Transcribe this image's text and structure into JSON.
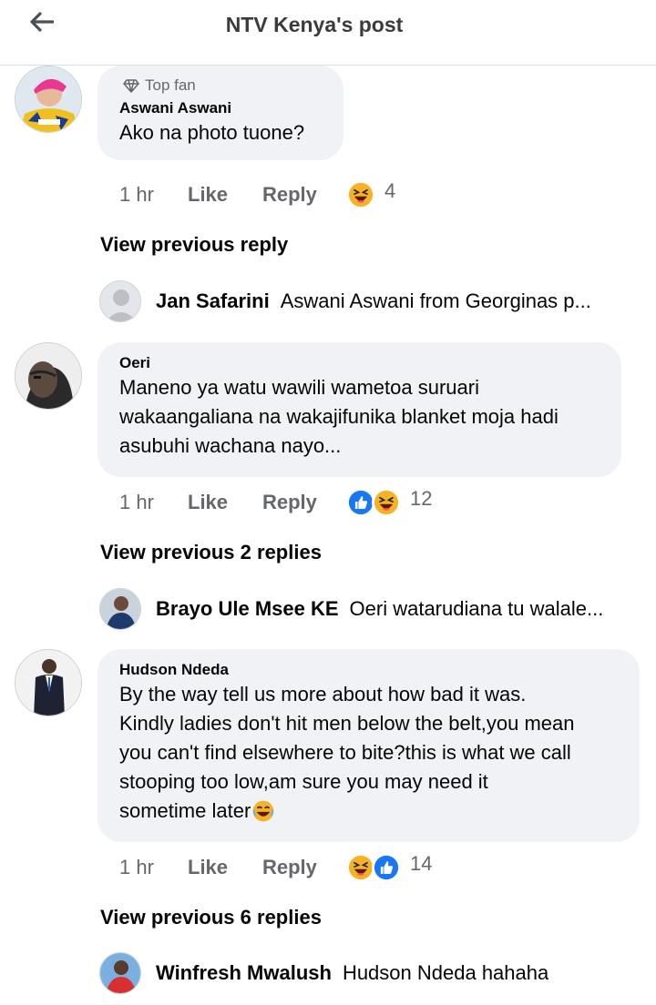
{
  "header": {
    "title": "NTV Kenya's post"
  },
  "comments": [
    {
      "badge": "Top fan",
      "author": "Aswani Aswani",
      "text": "Ako na photo tuone?",
      "time": "1 hr",
      "like": "Like",
      "reply": "Reply",
      "reactions": [
        "haha"
      ],
      "reaction_count": "4",
      "view_previous": "View previous reply",
      "latest_reply": {
        "name": "Jan Safarini",
        "text": "Aswani Aswani from Georginas p..."
      }
    },
    {
      "author": "Oeri",
      "text_lines": [
        "Maneno ya watu wawili wametoa suruari",
        "wakaangaliana na wakajifunika blanket moja hadi",
        "asubuhi wachana nayo..."
      ],
      "time": "1 hr",
      "like": "Like",
      "reply": "Reply",
      "reactions": [
        "like",
        "haha"
      ],
      "reaction_count": "12",
      "view_previous": "View previous 2 replies",
      "latest_reply": {
        "name": "Brayo Ule Msee KE",
        "text": "Oeri watarudiana tu walale..."
      }
    },
    {
      "author": "Hudson Ndeda",
      "text_lines": [
        "By the way tell us more about how bad it was.",
        "Kindly ladies don't hit men below the belt,you mean",
        "you can't find elsewhere to bite?this is what we call",
        "stooping too low,am sure you may need it",
        "sometime later"
      ],
      "time": "1 hr",
      "like": "Like",
      "reply": "Reply",
      "reactions": [
        "haha",
        "like"
      ],
      "reaction_count": "14",
      "view_previous": "View previous 6 replies",
      "latest_reply": {
        "name": "Winfresh Mwalush",
        "text": "Hudson Ndeda hahaha"
      }
    }
  ],
  "colors": {
    "like_blue": "#1877f2",
    "haha_yellow": "#f7b125",
    "bubble": "#f0f2f5",
    "meta_gray": "#65676b"
  }
}
